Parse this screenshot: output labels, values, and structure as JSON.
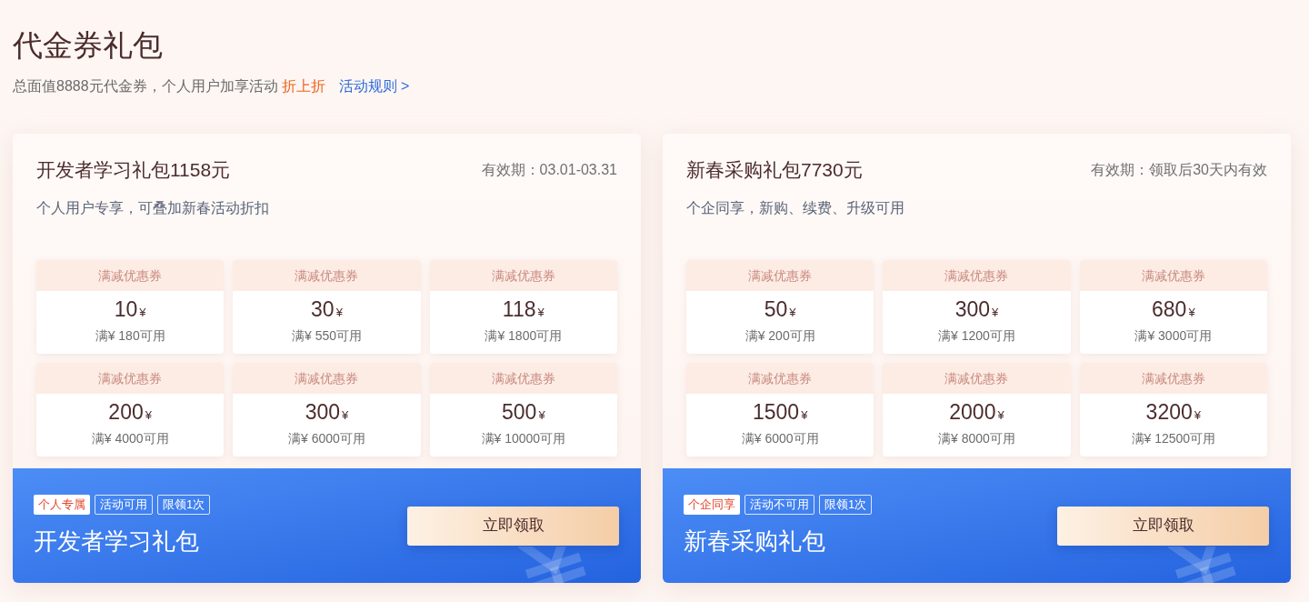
{
  "header": {
    "title": "代金券礼包",
    "subtitle": {
      "text": "总面值8888元代金券，个人用户加享活动",
      "highlight": "折上折"
    },
    "rules_link": "活动规则 >"
  },
  "packages": [
    {
      "title": "开发者学习礼包1158元",
      "validity": "有效期：03.01-03.31",
      "description": "个人用户专享，可叠加新春活动折扣",
      "coupons": [
        {
          "label": "满减优惠券",
          "amount": "10",
          "currency": "¥",
          "condition": "满¥ 180可用"
        },
        {
          "label": "满减优惠券",
          "amount": "30",
          "currency": "¥",
          "condition": "满¥ 550可用"
        },
        {
          "label": "满减优惠券",
          "amount": "118",
          "currency": "¥",
          "condition": "满¥ 1800可用"
        },
        {
          "label": "满减优惠券",
          "amount": "200",
          "currency": "¥",
          "condition": "满¥ 4000可用"
        },
        {
          "label": "满减优惠券",
          "amount": "300",
          "currency": "¥",
          "condition": "满¥ 6000可用"
        },
        {
          "label": "满减优惠券",
          "amount": "500",
          "currency": "¥",
          "condition": "满¥ 10000可用"
        }
      ],
      "tags": [
        {
          "text": "个人专属",
          "kind": "solid"
        },
        {
          "text": "活动可用",
          "kind": "outline"
        },
        {
          "text": "限领1次",
          "kind": "outline"
        }
      ],
      "name": "开发者学习礼包",
      "button": "立即领取"
    },
    {
      "title": "新春采购礼包7730元",
      "validity": "有效期：领取后30天内有效",
      "description": "个企同享，新购、续费、升级可用",
      "coupons": [
        {
          "label": "满减优惠券",
          "amount": "50",
          "currency": "¥",
          "condition": "满¥ 200可用"
        },
        {
          "label": "满减优惠券",
          "amount": "300",
          "currency": "¥",
          "condition": "满¥ 1200可用"
        },
        {
          "label": "满减优惠券",
          "amount": "680",
          "currency": "¥",
          "condition": "满¥ 3000可用"
        },
        {
          "label": "满减优惠券",
          "amount": "1500",
          "currency": "¥",
          "condition": "满¥ 6000可用"
        },
        {
          "label": "满减优惠券",
          "amount": "2000",
          "currency": "¥",
          "condition": "满¥ 8000可用"
        },
        {
          "label": "满减优惠券",
          "amount": "3200",
          "currency": "¥",
          "condition": "满¥ 12500可用"
        }
      ],
      "tags": [
        {
          "text": "个企同享",
          "kind": "solid"
        },
        {
          "text": "活动不可用",
          "kind": "outline"
        },
        {
          "text": "限领1次",
          "kind": "outline"
        }
      ],
      "name": "新春采购礼包",
      "button": "立即领取"
    }
  ]
}
